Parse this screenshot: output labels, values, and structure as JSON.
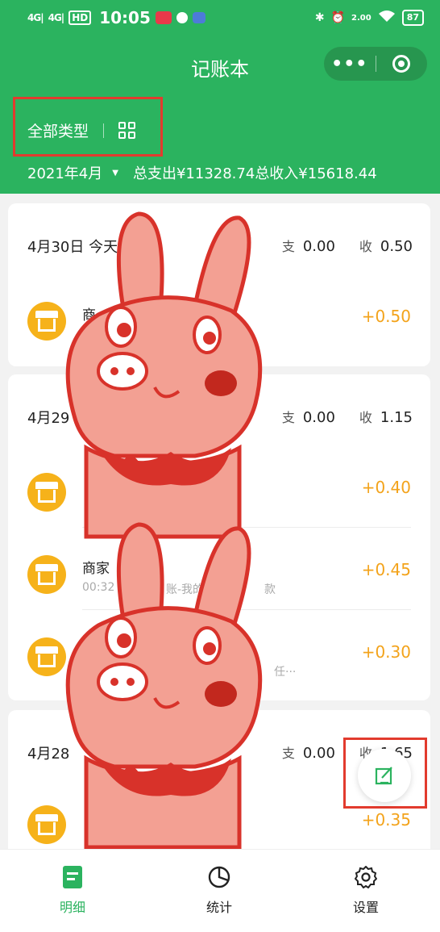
{
  "status_bar": {
    "signal_1": "4G|",
    "signal_2": "4G|",
    "time": "10:05",
    "net_speed": "2.00",
    "battery": "87"
  },
  "header": {
    "title": "记账本",
    "capsule_more": "•••",
    "filter_label": "全部类型",
    "month": "2021年4月",
    "total_expense": "总支出¥11328.74",
    "total_income": "总收入¥15618.44"
  },
  "labels": {
    "expense": "支",
    "income": "收"
  },
  "days": [
    {
      "date": "4月30日 今天",
      "expense": "0.00",
      "income": "0.50",
      "records": [
        {
          "name": "商",
          "sub": "",
          "amount": "+0.50"
        }
      ]
    },
    {
      "date": "4月29",
      "expense": "0.00",
      "income": "1.15",
      "records": [
        {
          "name": "",
          "sub": "",
          "amount": "+0.40"
        },
        {
          "name": "商家",
          "sub": "00:32",
          "sub2": "账-我的",
          "sub3": "款",
          "amount": "+0.45"
        },
        {
          "name": "",
          "sub": "任···",
          "amount": "+0.30"
        }
      ]
    },
    {
      "date": "4月28",
      "expense": "0.00",
      "income": "1.65",
      "records": [
        {
          "name": "",
          "sub": "",
          "amount": "+0.35"
        }
      ]
    }
  ],
  "tabbar": {
    "detail": "明细",
    "stats": "统计",
    "settings": "设置"
  },
  "colors": {
    "brand_green": "#2bb35f",
    "amount_orange": "#f3a31b",
    "avatar_yellow": "#f6b21a",
    "highlight_red": "#e23b2e"
  }
}
